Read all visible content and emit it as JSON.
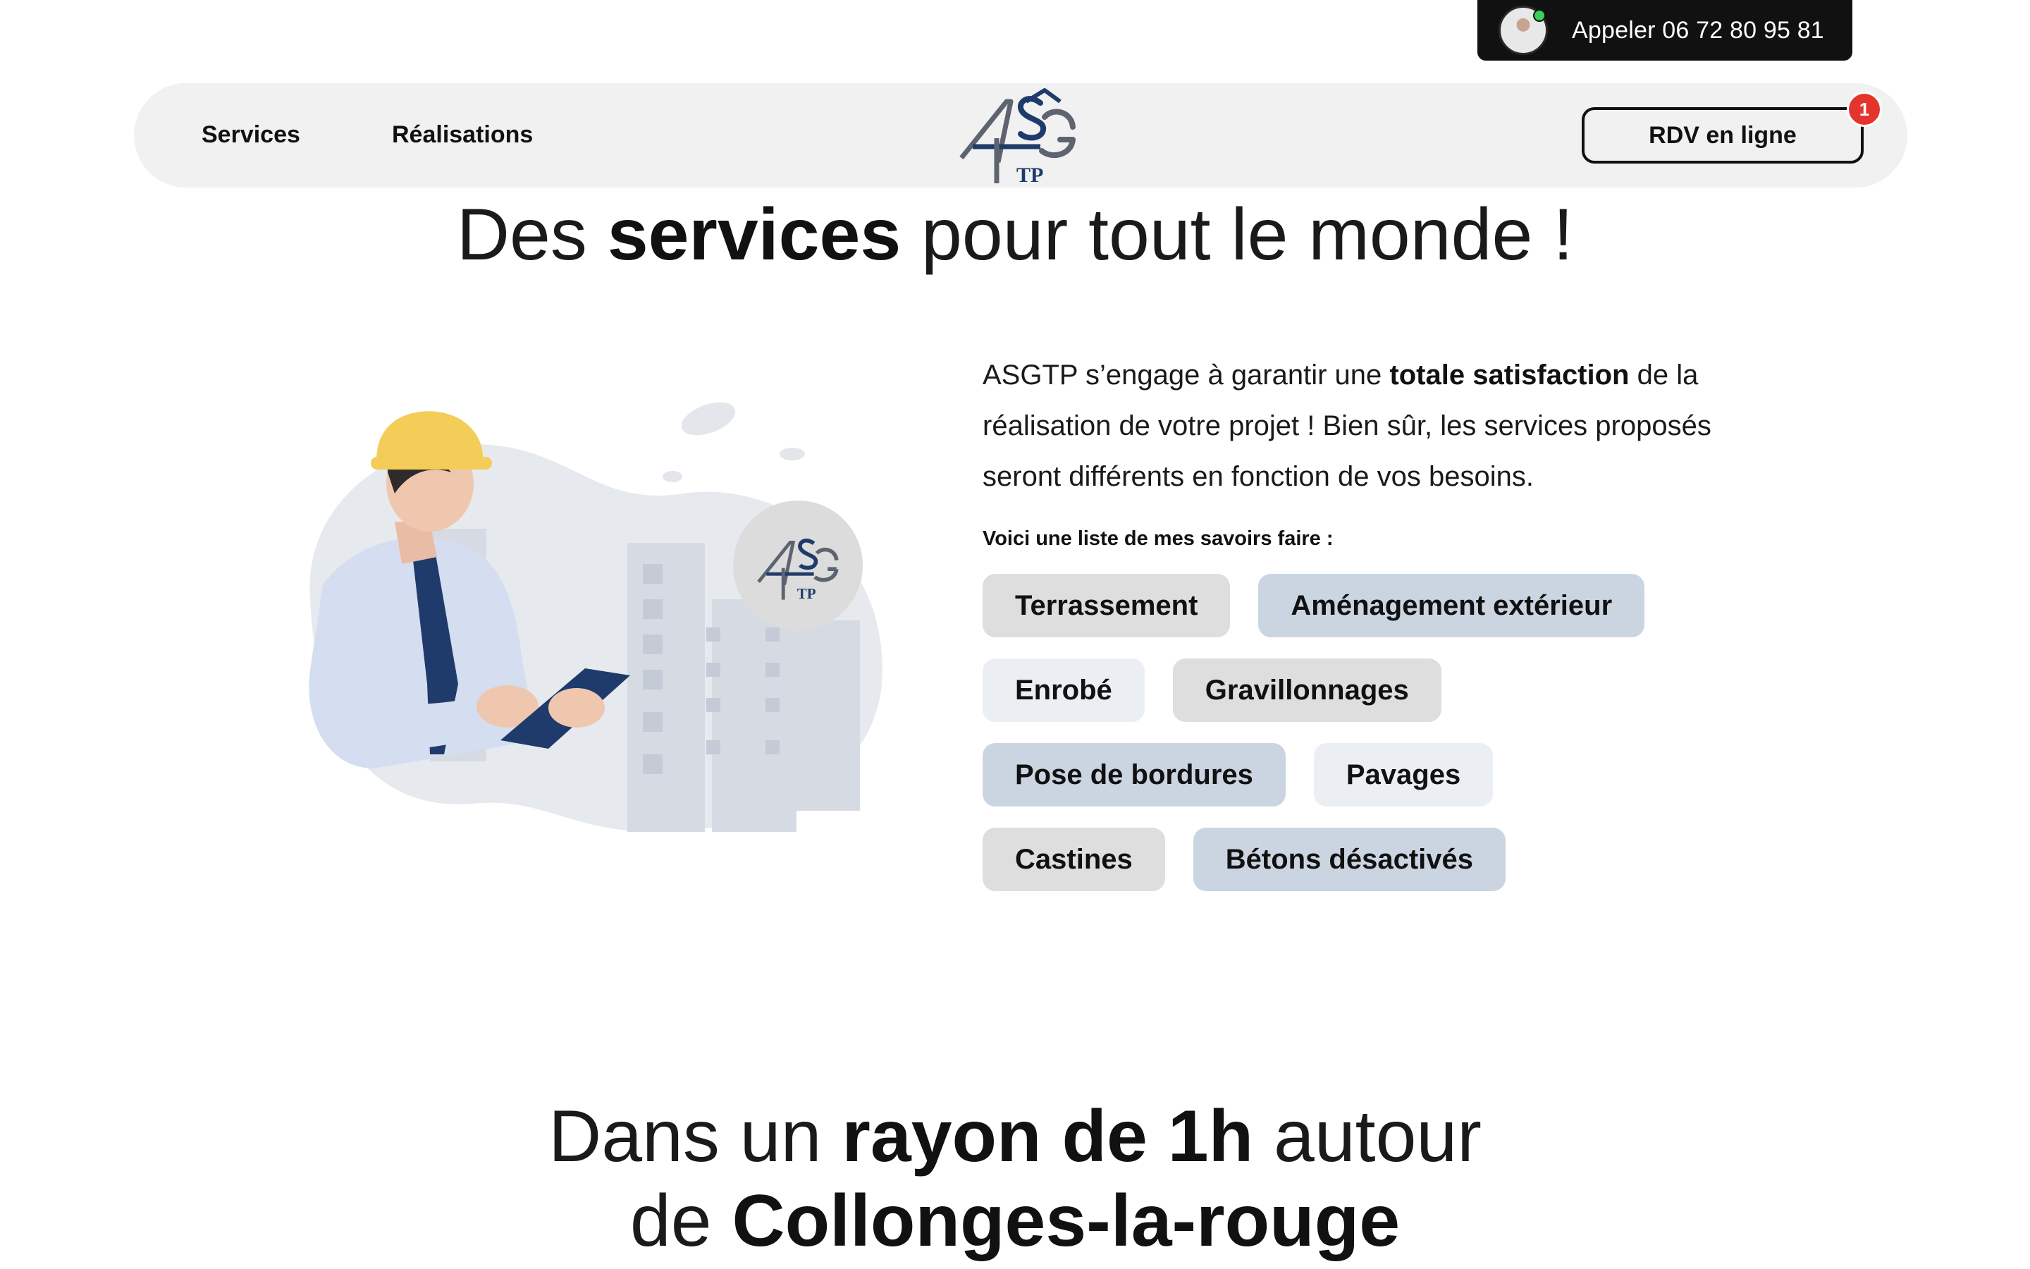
{
  "call": {
    "label": "Appeler 06 72 80 95 81"
  },
  "nav": {
    "links": [
      "Services",
      "Réalisations"
    ],
    "logo_alt": "ASGTP",
    "rdv_label": "RDV en ligne",
    "rdv_badge": "1"
  },
  "hero": {
    "title_pre": "Des ",
    "title_bold": "services",
    "title_post": " pour tout le monde !"
  },
  "intro": {
    "text_pre": "ASGTP s’engage à garantir une ",
    "text_bold": "totale satisfaction",
    "text_post": " de la réalisation de votre projet ! Bien sûr, les services proposés seront différents en fonction de vos besoins.",
    "list_heading": "Voici une liste de mes savoirs faire :"
  },
  "skills": [
    [
      "Terrassement",
      "Aménagement extérieur"
    ],
    [
      "Enrobé",
      "Gravillonnages"
    ],
    [
      "Pose de bordures",
      "Pavages"
    ],
    [
      "Castines",
      "Bétons désactivés"
    ]
  ],
  "area": {
    "line1_pre": "Dans un ",
    "line1_bold": "rayon de 1h",
    "line1_post": " autour",
    "line2_pre": "de ",
    "line2_bold": "Collonges-la-rouge"
  },
  "colors": {
    "tag_grey": "#dedede",
    "tag_blue": "#cbd5e2",
    "tag_light": "#ebeff4",
    "badge_red": "#e5342c",
    "helmet_yellow": "#f3cd57",
    "tie_navy": "#1f3b6b"
  },
  "icons": {
    "avatar": "person-avatar-icon",
    "logo": "asgtp-logo-icon",
    "illustration": "worker-with-tablet-illustration"
  }
}
